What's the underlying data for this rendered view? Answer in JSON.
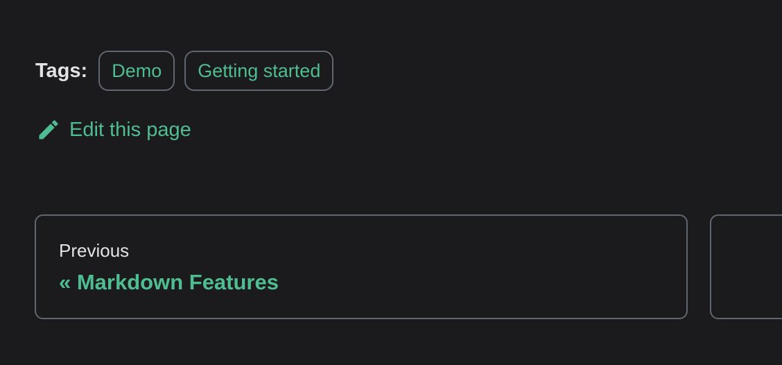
{
  "tags": {
    "label": "Tags:",
    "items": [
      "Demo",
      "Getting started"
    ]
  },
  "edit": {
    "icon": "pencil-icon",
    "label": "Edit this page"
  },
  "pagination": {
    "previous": {
      "sublabel": "Previous",
      "title": "« Markdown Features"
    }
  },
  "colors": {
    "background": "#1b1b1d",
    "accent": "#4fbd92",
    "border": "#606770",
    "text": "#e3e3e3"
  }
}
